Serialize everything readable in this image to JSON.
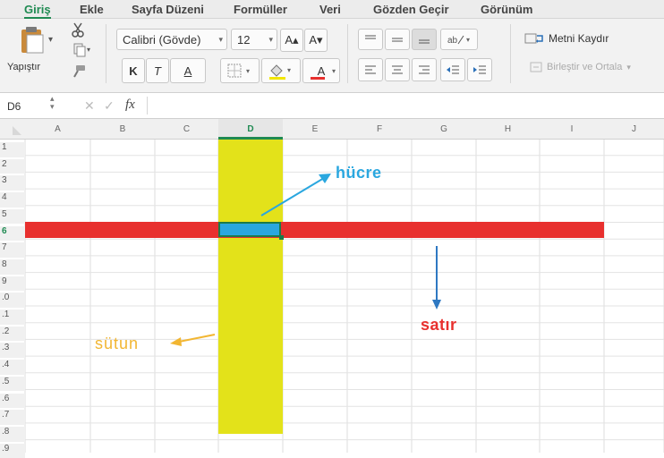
{
  "tabs": [
    "Giriş",
    "Ekle",
    "Sayfa Düzeni",
    "Formüller",
    "Veri",
    "Gözden Geçir",
    "Görünüm"
  ],
  "active_tab": "Giriş",
  "ribbon": {
    "paste_label": "Yapıştır",
    "font_name": "Calibri (Gövde)",
    "font_size": "12",
    "grow_font": "A▴",
    "shrink_font": "A▾",
    "bold": "K",
    "italic": "T",
    "underline": "A",
    "font_color": "A",
    "wrap_text": "Metni Kaydır",
    "merge_center": "Birleştir ve Ortala"
  },
  "formula_bar": {
    "name_box": "D6",
    "fx": "fx"
  },
  "columns": [
    "A",
    "B",
    "C",
    "D",
    "E",
    "F",
    "G",
    "H",
    "I",
    "J"
  ],
  "rows": [
    "1",
    "2",
    "3",
    "4",
    "5",
    "6",
    "7",
    "8",
    "9",
    ".0",
    ".1",
    ".2",
    ".3",
    ".4",
    ".5",
    ".6",
    ".7",
    ".8",
    ".9"
  ],
  "annotations": {
    "cell": "hücre",
    "row": "satır",
    "column": "sütun"
  },
  "colors": {
    "accent_green": "#1f8a52",
    "column_highlight": "#e3e21a",
    "row_highlight": "#e8302e",
    "selected_cell": "#2aa7df",
    "cell_label": "#2aa7df",
    "row_label": "#e8302e",
    "column_label": "#f2b632"
  }
}
